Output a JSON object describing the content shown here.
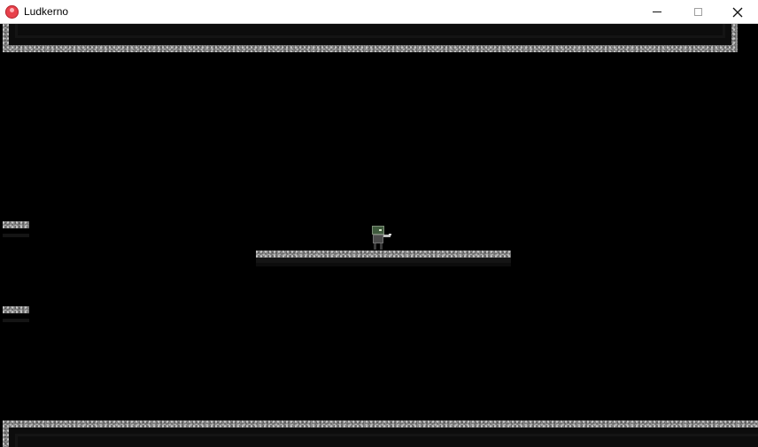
{
  "window": {
    "title": "Ludkerno",
    "controls": [
      "minimize",
      "maximize",
      "close"
    ]
  },
  "icons": {
    "app": "app-icon",
    "minimize": "minimize-icon",
    "maximize": "maximize-icon",
    "close": "close-icon"
  },
  "game": {
    "background_color": "#000000",
    "tile_style": "gray-stone",
    "player": "player-character"
  }
}
